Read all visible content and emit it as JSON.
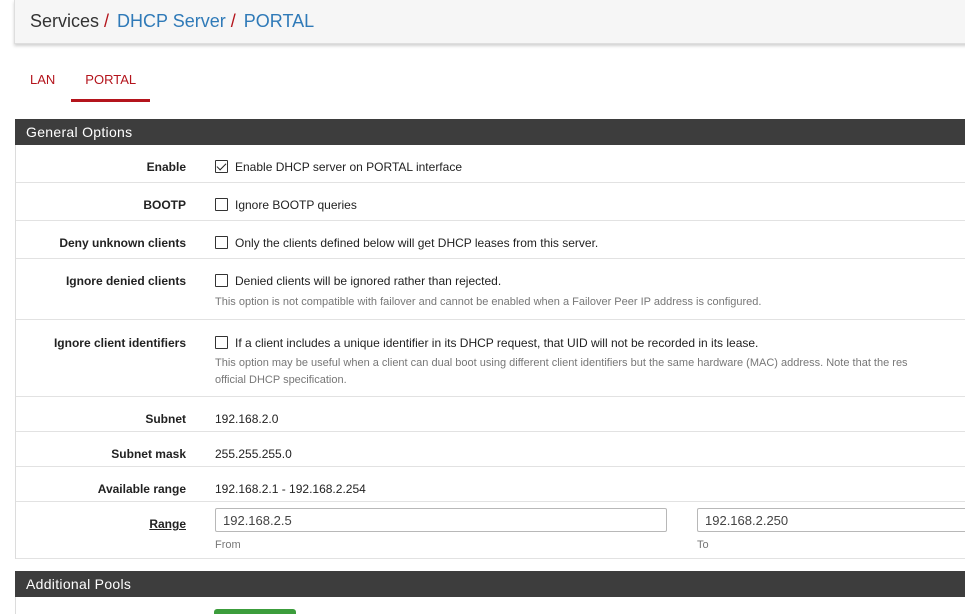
{
  "breadcrumb": {
    "root": "Services",
    "separator": "/",
    "items": [
      "DHCP Server",
      "PORTAL"
    ]
  },
  "tabs": [
    {
      "label": "LAN",
      "active": false
    },
    {
      "label": "PORTAL",
      "active": true
    }
  ],
  "general_options": {
    "heading": "General Options",
    "enable": {
      "label": "Enable",
      "text": "Enable DHCP server on PORTAL interface",
      "checked": true
    },
    "bootp": {
      "label": "BOOTP",
      "text": "Ignore BOOTP queries",
      "checked": false
    },
    "deny_unknown": {
      "label": "Deny unknown clients",
      "text": "Only the clients defined below will get DHCP leases from this server.",
      "checked": false
    },
    "ignore_denied": {
      "label": "Ignore denied clients",
      "text": "Denied clients will be ignored rather than rejected.",
      "help": "This option is not compatible with failover and cannot be enabled when a Failover Peer IP address is configured.",
      "checked": false
    },
    "ignore_client_ids": {
      "label": "Ignore client identifiers",
      "text": "If a client includes a unique identifier in its DHCP request, that UID will not be recorded in its lease.",
      "help_line1": "This option may be useful when a client can dual boot using different client identifiers but the same hardware (MAC) address. Note that the res",
      "help_line2": "official DHCP specification.",
      "checked": false
    },
    "subnet": {
      "label": "Subnet",
      "value": "192.168.2.0"
    },
    "subnet_mask": {
      "label": "Subnet mask",
      "value": "255.255.255.0"
    },
    "available_range": {
      "label": "Available range",
      "value": "192.168.2.1 - 192.168.2.254"
    },
    "range": {
      "label": "Range",
      "from_value": "192.168.2.5",
      "from_label": "From",
      "to_value": "192.168.2.250",
      "to_label": "To"
    }
  },
  "additional_pools": {
    "heading": "Additional Pools"
  },
  "colors": {
    "accent_red": "#b4141c",
    "link_blue": "#2f7ab8",
    "panel_heading": "#3d3d3d",
    "button_green": "#3c9d3c"
  }
}
